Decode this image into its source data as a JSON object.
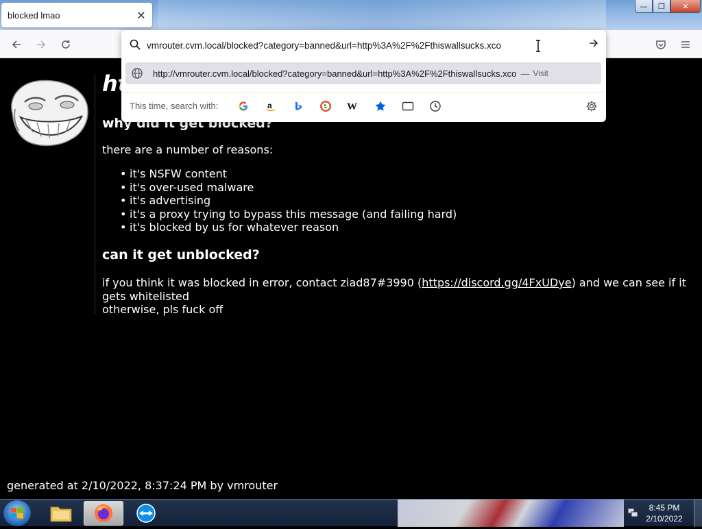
{
  "window": {
    "tab_title": "blocked lmao",
    "tab_close": "✕",
    "buttons": {
      "minimize": "—",
      "maximize": "❐",
      "close": "✕"
    }
  },
  "toolbar": {
    "url_value": "vmrouter.cvm.local/blocked?category=banned&url=http%3A%2F%2Fthiswallsucks.xco",
    "suggestion": {
      "url": "http://vmrouter.cvm.local/blocked?category=banned&url=http%3A%2F%2Fthiswallsucks.xco",
      "separator": "—",
      "action": "Visit"
    },
    "search_engines_label": "This time, search with:",
    "search_engines": [
      "google-icon",
      "amazon-icon",
      "bing-icon",
      "duckduckgo-icon",
      "wikipedia-icon",
      "bookmarks-icon",
      "tabs-icon",
      "history-icon"
    ]
  },
  "page": {
    "heading": "ht",
    "why_heading": "why did it get blocked?",
    "reasons_intro": "there are a number of reasons:",
    "reasons": [
      "it's NSFW content",
      "it's over-used malware",
      "it's advertising",
      "it's a proxy trying to bypass this message (and failing hard)",
      "it's blocked by us for whatever reason"
    ],
    "unblock_heading": "can it get unblocked?",
    "contact_before": "if you think it was blocked in error, contact ziad87#3990 (",
    "contact_link": "https://discord.gg/4FxUDye",
    "contact_after": ") and we can see if it gets whitelisted",
    "contact_line2": "otherwise, pls fuck off",
    "footer": "generated at 2/10/2022, 8:37:24 PM by vmrouter"
  },
  "taskbar": {
    "time": "8:45 PM",
    "date": "2/10/2022"
  },
  "colors": {
    "page_bg": "#000000",
    "page_text": "#ffffff",
    "suggestion_bg": "#e0e0e6",
    "toolbar_bg": "#f9f9fb"
  }
}
